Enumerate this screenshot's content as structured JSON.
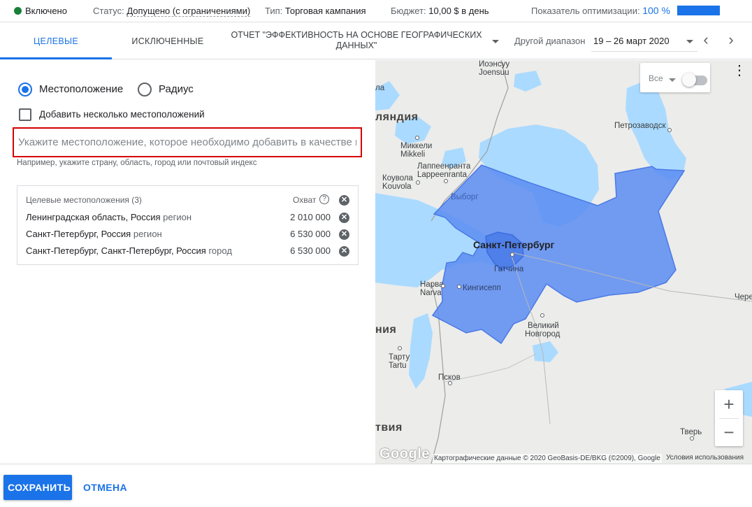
{
  "status_bar": {
    "enabled": "Включено",
    "status_label": "Статус:",
    "status_value": "Допущено (с ограничениями)",
    "type_label": "Тип:",
    "type_value": "Торговая кампания",
    "budget_label": "Бюджет:",
    "budget_value": "10,00 $ в день",
    "optimization_label": "Показатель оптимизации:",
    "optimization_value": "100 %",
    "optimization_score": 1.0,
    "colors": {
      "enabled_dot": "#188038",
      "accent": "#1a73e8"
    }
  },
  "tabs": {
    "targeted": "Целевые",
    "excluded": "Исключенные",
    "report": "Отчет \"Эффективность на основе географических данных\""
  },
  "date_range": {
    "label": "Другой диапазон",
    "value": "19 – 26 март 2020"
  },
  "location_form": {
    "radio_location": "Местоположение",
    "radio_radius": "Радиус",
    "selected_radio": "Местоположение",
    "multi_checkbox": "Добавить несколько местоположений",
    "multi_checked": false,
    "input_placeholder": "Укажите местоположение, которое необходимо добавить в качестве цели",
    "input_value": "",
    "hint": "Например, укажите страну, область, город или почтовый индекс"
  },
  "targets": {
    "header": "Целевые местоположения (3)",
    "reach_header": "Охват",
    "rows": [
      {
        "name": "Ленинградская область, Россия",
        "kind": "регион",
        "reach": "2 010 000"
      },
      {
        "name": "Санкт-Петербург, Россия",
        "kind": "регион",
        "reach": "6 530 000"
      },
      {
        "name": "Санкт-Петербург, Санкт-Петербург, Россия",
        "kind": "город",
        "reach": "6 530 000"
      }
    ]
  },
  "map": {
    "filter_label": "Все",
    "labels": {
      "yoensuu": "Йоэнсуу",
      "joensuu": "Joensuu",
      "finland": "ляндия",
      "petrozavodsk": "Петрозаводск",
      "mikkeli_ru": "Миккели",
      "mikkeli": "Mikkeli",
      "lappeenranta_ru": "Лаппеенранта",
      "lappeenranta": "Lappeenranta",
      "kouvola_ru": "Коувола",
      "kouvola": "Kouvola",
      "vyborg": "Выборг",
      "spb": "Санкт-Петербург",
      "gatchina": "Гатчина",
      "narva_ru": "Нарва",
      "narva": "Narva",
      "kingisepp": "Кингисепп",
      "estonia": "ния",
      "velikiy": "Великий",
      "novgorod": "Новгород",
      "tartu_ru": "Тарту",
      "tartu": "Tartu",
      "pskov": "Псков",
      "latvia": "твия",
      "tver": "Тверь",
      "cher": "Чере",
      "ila": "ла"
    },
    "zoom_in": "+",
    "zoom_out": "−",
    "google": "Google",
    "attribution": "Картографические данные © 2020 GeoBasis-DE/BKG (©2009), Google",
    "terms": "Условия использования",
    "colors": {
      "land": "#ececea",
      "water": "#aadaff",
      "target_fill": "#5c8df2",
      "target_stroke": "#4a79e6"
    }
  },
  "footer": {
    "save": "Сохранить",
    "cancel": "Отмена"
  }
}
